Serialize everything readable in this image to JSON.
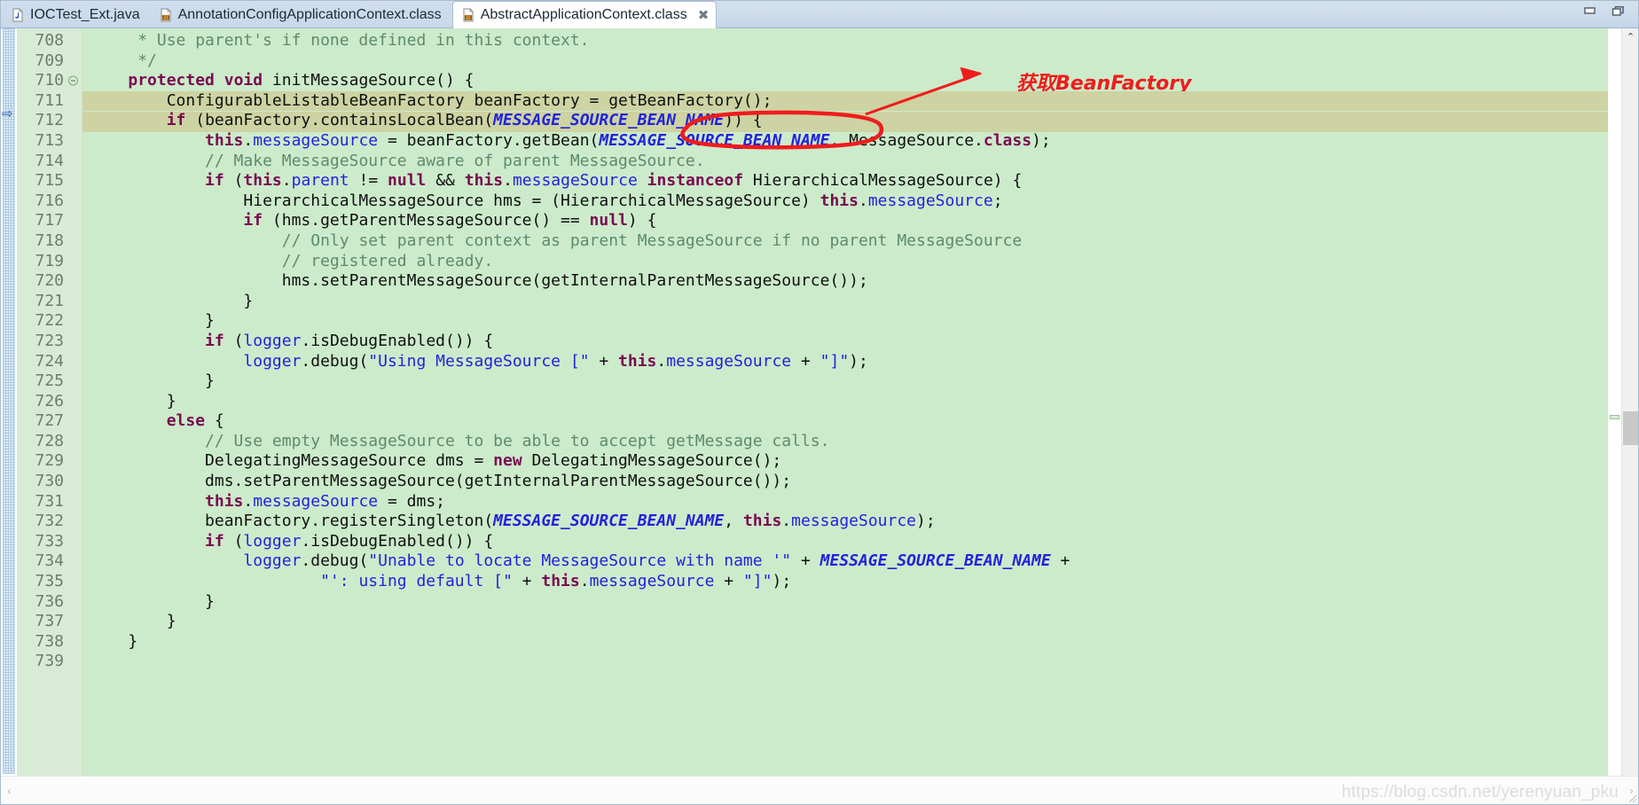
{
  "window": {
    "minimize_label": "–",
    "maximize_label": "❐"
  },
  "tabs": [
    {
      "label": "IOCTest_Ext.java",
      "icon": "java-file-icon",
      "active": false,
      "closable": false
    },
    {
      "label": "AnnotationConfigApplicationContext.class",
      "icon": "class-file-icon",
      "active": false,
      "closable": false
    },
    {
      "label": "AbstractApplicationContext.class",
      "icon": "class-file-icon",
      "active": true,
      "closable": true,
      "close_label": "✖"
    }
  ],
  "editor": {
    "first_line": 708,
    "highlighted_line": 711,
    "folded_marker_line": 710,
    "current_line_marker": "⇨",
    "lines": [
      {
        "n": 708,
        "tokens": [
          {
            "t": "plain",
            "s": "     "
          },
          {
            "t": "cmt",
            "s": "* Use parent's if none defined in this context."
          }
        ]
      },
      {
        "n": 709,
        "tokens": [
          {
            "t": "plain",
            "s": "     "
          },
          {
            "t": "cmt",
            "s": "*/"
          }
        ]
      },
      {
        "n": 710,
        "fold": true,
        "tokens": [
          {
            "t": "plain",
            "s": "    "
          },
          {
            "t": "kw",
            "s": "protected void"
          },
          {
            "t": "plain",
            "s": " initMessageSource() {"
          }
        ]
      },
      {
        "n": 711,
        "hl": true,
        "tokens": [
          {
            "t": "plain",
            "s": "        ConfigurableListableBeanFactory "
          },
          {
            "t": "fld2",
            "s": "beanFactory"
          },
          {
            "t": "plain",
            "s": " = getBeanFactory();"
          }
        ]
      },
      {
        "n": 712,
        "tokens": [
          {
            "t": "plain",
            "s": "        "
          },
          {
            "t": "kw",
            "s": "if"
          },
          {
            "t": "plain",
            "s": " (beanFactory.containsLocalBean("
          },
          {
            "t": "cst",
            "s": "MESSAGE_SOURCE_BEAN_NAME"
          },
          {
            "t": "plain",
            "s": ")) {"
          }
        ]
      },
      {
        "n": 713,
        "tokens": [
          {
            "t": "plain",
            "s": "            "
          },
          {
            "t": "kw",
            "s": "this"
          },
          {
            "t": "plain",
            "s": "."
          },
          {
            "t": "fld",
            "s": "messageSource"
          },
          {
            "t": "plain",
            "s": " = beanFactory.getBean("
          },
          {
            "t": "cst",
            "s": "MESSAGE_SOURCE_BEAN_NAME"
          },
          {
            "t": "plain",
            "s": ", MessageSource."
          },
          {
            "t": "kw",
            "s": "class"
          },
          {
            "t": "plain",
            "s": ");"
          }
        ]
      },
      {
        "n": 714,
        "tokens": [
          {
            "t": "plain",
            "s": "            "
          },
          {
            "t": "cmt",
            "s": "// Make MessageSource aware of parent MessageSource."
          }
        ]
      },
      {
        "n": 715,
        "tokens": [
          {
            "t": "plain",
            "s": "            "
          },
          {
            "t": "kw",
            "s": "if"
          },
          {
            "t": "plain",
            "s": " ("
          },
          {
            "t": "kw",
            "s": "this"
          },
          {
            "t": "plain",
            "s": "."
          },
          {
            "t": "fld",
            "s": "parent"
          },
          {
            "t": "plain",
            "s": " != "
          },
          {
            "t": "kw",
            "s": "null"
          },
          {
            "t": "plain",
            "s": " && "
          },
          {
            "t": "kw",
            "s": "this"
          },
          {
            "t": "plain",
            "s": "."
          },
          {
            "t": "fld",
            "s": "messageSource"
          },
          {
            "t": "plain",
            "s": " "
          },
          {
            "t": "kw",
            "s": "instanceof"
          },
          {
            "t": "plain",
            "s": " HierarchicalMessageSource) {"
          }
        ]
      },
      {
        "n": 716,
        "tokens": [
          {
            "t": "plain",
            "s": "                HierarchicalMessageSource hms = (HierarchicalMessageSource) "
          },
          {
            "t": "kw",
            "s": "this"
          },
          {
            "t": "plain",
            "s": "."
          },
          {
            "t": "fld",
            "s": "messageSource"
          },
          {
            "t": "plain",
            "s": ";"
          }
        ]
      },
      {
        "n": 717,
        "tokens": [
          {
            "t": "plain",
            "s": "                "
          },
          {
            "t": "kw",
            "s": "if"
          },
          {
            "t": "plain",
            "s": " (hms.getParentMessageSource() == "
          },
          {
            "t": "kw",
            "s": "null"
          },
          {
            "t": "plain",
            "s": ") {"
          }
        ]
      },
      {
        "n": 718,
        "tokens": [
          {
            "t": "plain",
            "s": "                    "
          },
          {
            "t": "cmt",
            "s": "// Only set parent context as parent MessageSource if no parent MessageSource"
          }
        ]
      },
      {
        "n": 719,
        "tokens": [
          {
            "t": "plain",
            "s": "                    "
          },
          {
            "t": "cmt",
            "s": "// registered already."
          }
        ]
      },
      {
        "n": 720,
        "tokens": [
          {
            "t": "plain",
            "s": "                    hms.setParentMessageSource(getInternalParentMessageSource());"
          }
        ]
      },
      {
        "n": 721,
        "tokens": [
          {
            "t": "plain",
            "s": "                }"
          }
        ]
      },
      {
        "n": 722,
        "tokens": [
          {
            "t": "plain",
            "s": "            }"
          }
        ]
      },
      {
        "n": 723,
        "tokens": [
          {
            "t": "plain",
            "s": "            "
          },
          {
            "t": "kw",
            "s": "if"
          },
          {
            "t": "plain",
            "s": " ("
          },
          {
            "t": "fld",
            "s": "logger"
          },
          {
            "t": "plain",
            "s": ".isDebugEnabled()) {"
          }
        ]
      },
      {
        "n": 724,
        "tokens": [
          {
            "t": "plain",
            "s": "                "
          },
          {
            "t": "fld",
            "s": "logger"
          },
          {
            "t": "plain",
            "s": ".debug("
          },
          {
            "t": "str",
            "s": "\"Using MessageSource [\""
          },
          {
            "t": "plain",
            "s": " + "
          },
          {
            "t": "kw",
            "s": "this"
          },
          {
            "t": "plain",
            "s": "."
          },
          {
            "t": "fld",
            "s": "messageSource"
          },
          {
            "t": "plain",
            "s": " + "
          },
          {
            "t": "str",
            "s": "\"]\""
          },
          {
            "t": "plain",
            "s": ");"
          }
        ]
      },
      {
        "n": 725,
        "tokens": [
          {
            "t": "plain",
            "s": "            }"
          }
        ]
      },
      {
        "n": 726,
        "tokens": [
          {
            "t": "plain",
            "s": "        }"
          }
        ]
      },
      {
        "n": 727,
        "tokens": [
          {
            "t": "plain",
            "s": "        "
          },
          {
            "t": "kw",
            "s": "else"
          },
          {
            "t": "plain",
            "s": " {"
          }
        ]
      },
      {
        "n": 728,
        "tokens": [
          {
            "t": "plain",
            "s": "            "
          },
          {
            "t": "cmt",
            "s": "// Use empty MessageSource to be able to accept getMessage calls."
          }
        ]
      },
      {
        "n": 729,
        "tokens": [
          {
            "t": "plain",
            "s": "            DelegatingMessageSource dms = "
          },
          {
            "t": "kw",
            "s": "new"
          },
          {
            "t": "plain",
            "s": " DelegatingMessageSource();"
          }
        ]
      },
      {
        "n": 730,
        "tokens": [
          {
            "t": "plain",
            "s": "            dms.setParentMessageSource(getInternalParentMessageSource());"
          }
        ]
      },
      {
        "n": 731,
        "tokens": [
          {
            "t": "plain",
            "s": "            "
          },
          {
            "t": "kw",
            "s": "this"
          },
          {
            "t": "plain",
            "s": "."
          },
          {
            "t": "fld",
            "s": "messageSource"
          },
          {
            "t": "plain",
            "s": " = dms;"
          }
        ]
      },
      {
        "n": 732,
        "tokens": [
          {
            "t": "plain",
            "s": "            beanFactory.registerSingleton("
          },
          {
            "t": "cst",
            "s": "MESSAGE_SOURCE_BEAN_NAME"
          },
          {
            "t": "plain",
            "s": ", "
          },
          {
            "t": "kw",
            "s": "this"
          },
          {
            "t": "plain",
            "s": "."
          },
          {
            "t": "fld",
            "s": "messageSource"
          },
          {
            "t": "plain",
            "s": ");"
          }
        ]
      },
      {
        "n": 733,
        "tokens": [
          {
            "t": "plain",
            "s": "            "
          },
          {
            "t": "kw",
            "s": "if"
          },
          {
            "t": "plain",
            "s": " ("
          },
          {
            "t": "fld",
            "s": "logger"
          },
          {
            "t": "plain",
            "s": ".isDebugEnabled()) {"
          }
        ]
      },
      {
        "n": 734,
        "tokens": [
          {
            "t": "plain",
            "s": "                "
          },
          {
            "t": "fld",
            "s": "logger"
          },
          {
            "t": "plain",
            "s": ".debug("
          },
          {
            "t": "str",
            "s": "\"Unable to locate MessageSource with name '\""
          },
          {
            "t": "plain",
            "s": " + "
          },
          {
            "t": "cst",
            "s": "MESSAGE_SOURCE_BEAN_NAME"
          },
          {
            "t": "plain",
            "s": " +"
          }
        ]
      },
      {
        "n": 735,
        "tokens": [
          {
            "t": "plain",
            "s": "                        "
          },
          {
            "t": "str",
            "s": "\"': using default [\""
          },
          {
            "t": "plain",
            "s": " + "
          },
          {
            "t": "kw",
            "s": "this"
          },
          {
            "t": "plain",
            "s": "."
          },
          {
            "t": "fld",
            "s": "messageSource"
          },
          {
            "t": "plain",
            "s": " + "
          },
          {
            "t": "str",
            "s": "\"]\""
          },
          {
            "t": "plain",
            "s": ");"
          }
        ]
      },
      {
        "n": 736,
        "tokens": [
          {
            "t": "plain",
            "s": "            }"
          }
        ]
      },
      {
        "n": 737,
        "tokens": [
          {
            "t": "plain",
            "s": "        }"
          }
        ]
      },
      {
        "n": 738,
        "tokens": [
          {
            "t": "plain",
            "s": "    }"
          }
        ]
      },
      {
        "n": 739,
        "tokens": [
          {
            "t": "plain",
            "s": ""
          }
        ]
      }
    ]
  },
  "annotation": {
    "text": "获取BeanFactory",
    "color": "#ef1c1c",
    "shape": "ellipse-around-getBeanFactory-call-with-arrow"
  },
  "scrollbars": {
    "v_up_label": "⌃",
    "v_down_label": "⌄",
    "h_left_label": "‹",
    "h_right_label": "›"
  },
  "watermark": {
    "text": "https://blog.csdn.net/yerenyuan_pku"
  },
  "colors": {
    "code_background": "#ccebcb",
    "gutter_background": "#d8ecd5",
    "highlight_line": "#cdd3a2",
    "keyword": "#7a0a52",
    "comment": "#5e8a6d",
    "string": "#2222dd",
    "field": "#2222dd",
    "constant": "#2222dd",
    "annotation_red": "#ef1c1c",
    "tab_bar": "#cddcec"
  }
}
